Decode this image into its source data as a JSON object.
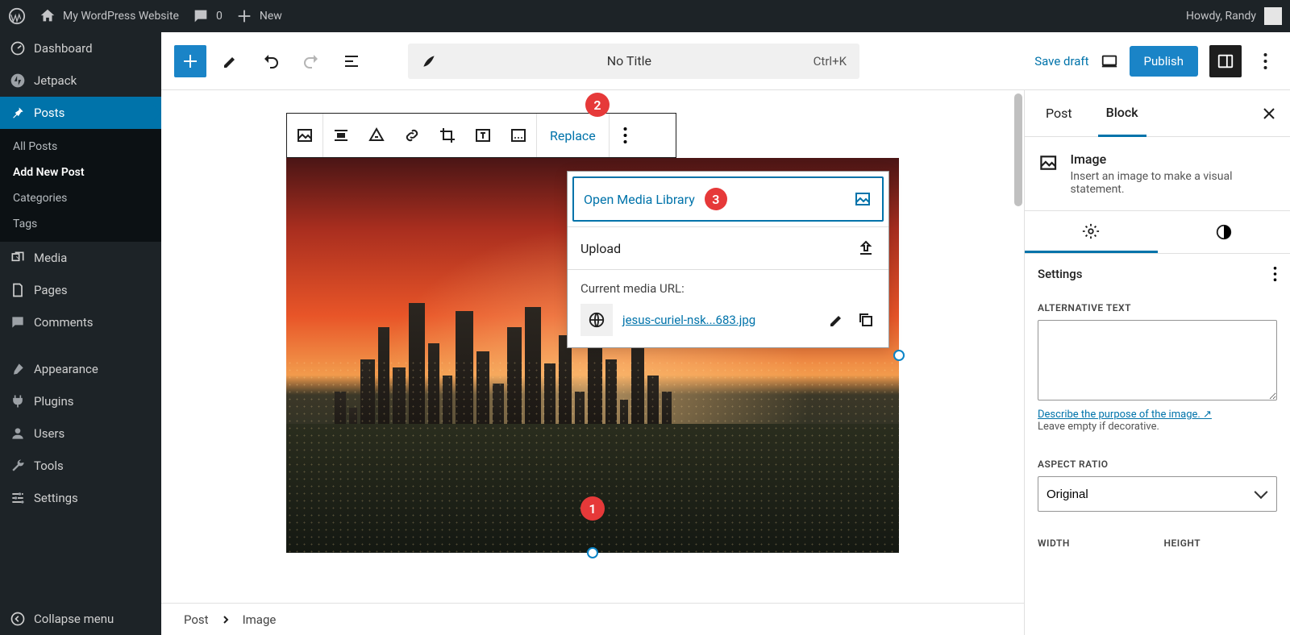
{
  "adminbar": {
    "site_title": "My WordPress Website",
    "comments_count": "0",
    "new_label": "New",
    "howdy": "Howdy, Randy"
  },
  "sidebar": {
    "items": [
      {
        "label": "Dashboard",
        "icon": "dashboard"
      },
      {
        "label": "Jetpack",
        "icon": "jetpack"
      },
      {
        "label": "Posts",
        "icon": "pin",
        "current": true,
        "submenu": [
          {
            "label": "All Posts"
          },
          {
            "label": "Add New Post",
            "current": true
          },
          {
            "label": "Categories"
          },
          {
            "label": "Tags"
          }
        ]
      },
      {
        "label": "Media",
        "icon": "media"
      },
      {
        "label": "Pages",
        "icon": "pages"
      },
      {
        "label": "Comments",
        "icon": "comments"
      },
      {
        "label": "Appearance",
        "icon": "appearance"
      },
      {
        "label": "Plugins",
        "icon": "plugins"
      },
      {
        "label": "Users",
        "icon": "users"
      },
      {
        "label": "Tools",
        "icon": "tools"
      },
      {
        "label": "Settings",
        "icon": "settings"
      }
    ],
    "collapse": "Collapse menu"
  },
  "editor_header": {
    "title_placeholder": "No Title",
    "shortcut": "Ctrl+K",
    "save_draft": "Save draft",
    "publish": "Publish"
  },
  "block_toolbar": {
    "replace": "Replace"
  },
  "popover": {
    "open_media": "Open Media Library",
    "upload": "Upload",
    "current_url_label": "Current media URL:",
    "url_text": "jesus-curiel-nsk...683.jpg"
  },
  "callouts": {
    "b1": "1",
    "b2": "2",
    "b3": "3"
  },
  "breadcrumb": {
    "a": "Post",
    "b": "Image"
  },
  "rpanel": {
    "tabs": {
      "post": "Post",
      "block": "Block"
    },
    "block": {
      "name": "Image",
      "desc": "Insert an image to make a visual statement."
    },
    "settings_title": "Settings",
    "alt_label": "ALTERNATIVE TEXT",
    "alt_help_link": "Describe the purpose of the image. ↗",
    "alt_help_text": "Leave empty if decorative.",
    "aspect_label": "ASPECT RATIO",
    "aspect_value": "Original",
    "width_label": "WIDTH",
    "height_label": "HEIGHT"
  }
}
